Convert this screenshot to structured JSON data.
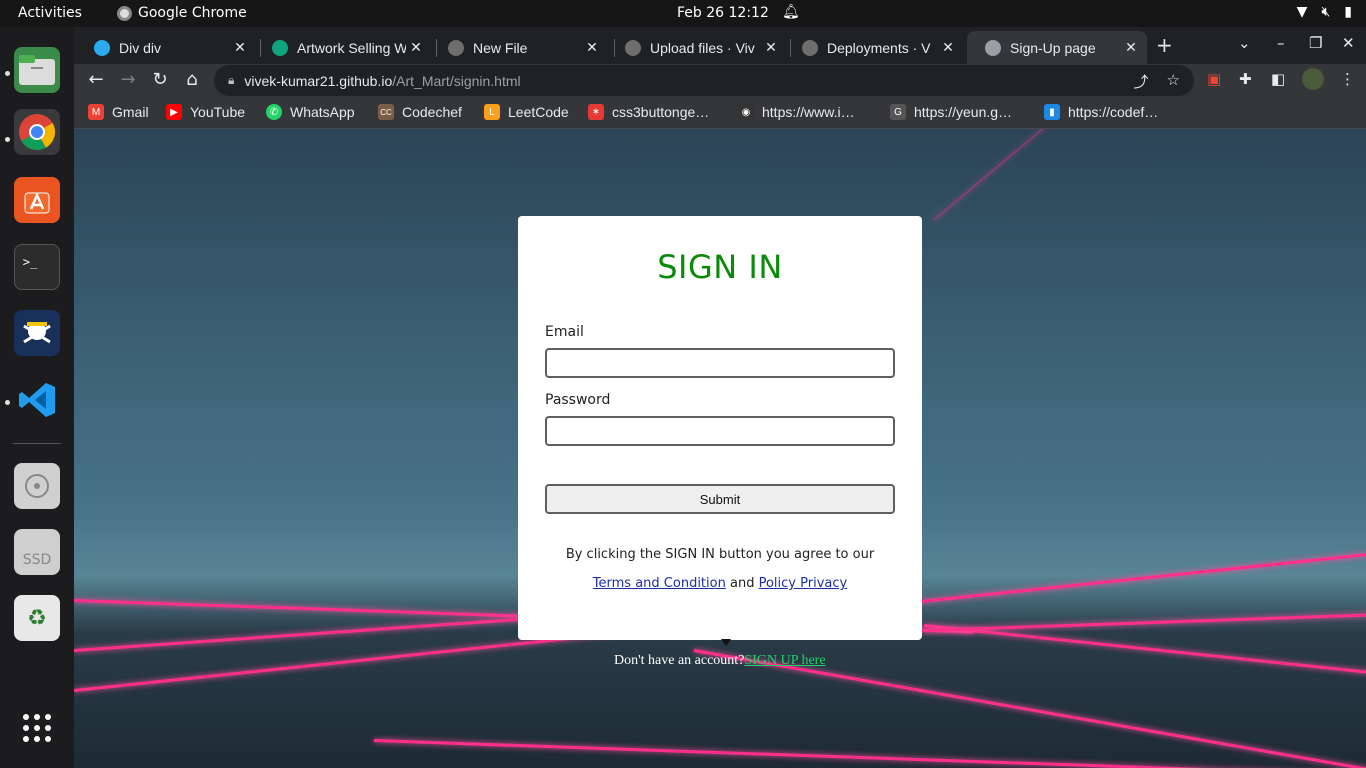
{
  "topbar": {
    "activities": "Activities",
    "app_name": "Google Chrome",
    "clock": "Feb 26  12:12"
  },
  "tabs": [
    {
      "label": "Div div",
      "favicon_color": "#2AABEE"
    },
    {
      "label": "Artwork Selling W",
      "favicon_color": "#10a37f"
    },
    {
      "label": "New File",
      "favicon_color": "#6e6e6e"
    },
    {
      "label": "Upload files · Viv",
      "favicon_color": "#6e6e6e"
    },
    {
      "label": "Deployments · V",
      "favicon_color": "#6e6e6e"
    },
    {
      "label": "Sign-Up page",
      "favicon_color": "#9aa0a6",
      "active": true
    }
  ],
  "address": {
    "host": "vivek-kumar21.github.io",
    "path": "/Art_Mart/signin.html"
  },
  "bookmarks": [
    {
      "label": "Gmail",
      "icon_color": "#ea4335",
      "icon": "M"
    },
    {
      "label": "YouTube",
      "icon_color": "#ff0000",
      "icon": "▶"
    },
    {
      "label": "WhatsApp",
      "icon_color": "#25d366",
      "icon": "✆"
    },
    {
      "label": "Codechef",
      "icon_color": "#7b5e45",
      "icon": "CC"
    },
    {
      "label": "LeetCode",
      "icon_color": "#f89f1b",
      "icon": "L"
    },
    {
      "label": "css3buttonge…",
      "icon_color": "#e53935",
      "icon": "✶"
    },
    {
      "label": "https://www.i…",
      "icon_color": "#333333",
      "icon": "◉"
    },
    {
      "label": "https://yeun.g…",
      "icon_color": "#555555",
      "icon": "G"
    },
    {
      "label": "https://codef…",
      "icon_color": "#1e88e5",
      "icon": "▮"
    }
  ],
  "form": {
    "title": "SIGN IN",
    "email_label": "Email",
    "email_value": "",
    "password_label": "Password",
    "password_value": "",
    "submit_label": "Submit",
    "agree_text": "By clicking the SIGN IN button you agree to our",
    "terms_link": "Terms and Condition",
    "and_text": "and",
    "privacy_link": "Policy Privacy"
  },
  "signup": {
    "prompt": "Don't have an account?",
    "link": "SIGN UP here"
  },
  "colors": {
    "title_green": "#0a8a0a",
    "link_blue": "#1a2fa8",
    "signup_green": "#1fd36a",
    "laser_pink": "#ff2f8a"
  }
}
